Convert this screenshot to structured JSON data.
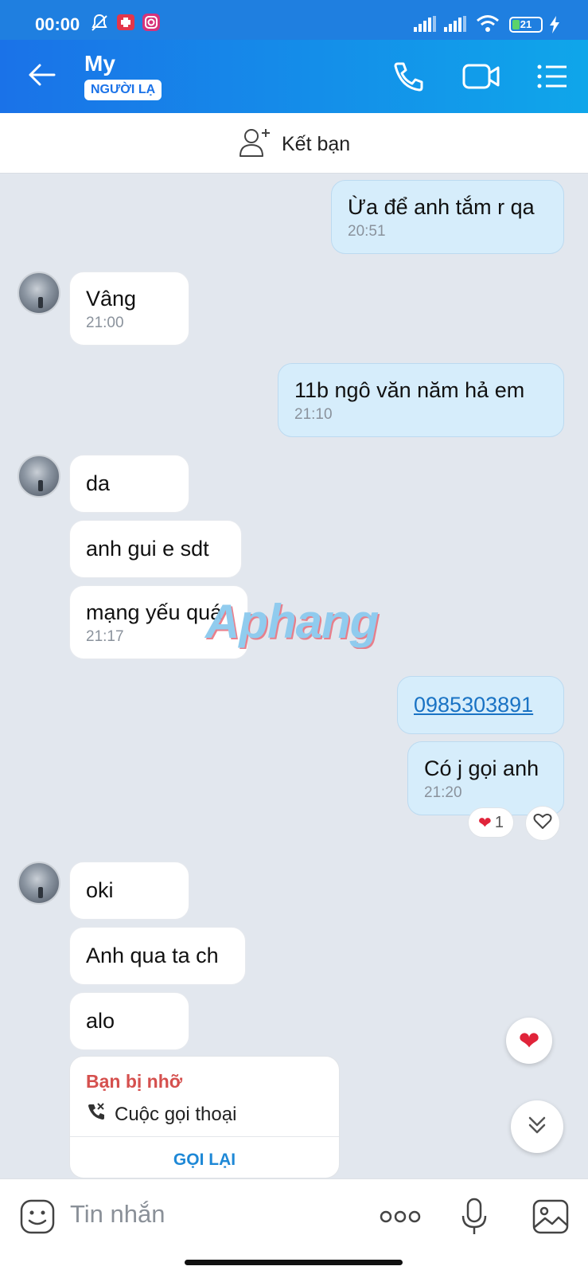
{
  "status_bar": {
    "time": "00:00",
    "battery": "21"
  },
  "header": {
    "contact_name": "My",
    "badge": "NGƯỜI LẠ"
  },
  "add_friend": {
    "label": "Kết bạn"
  },
  "messages": [
    {
      "text": "Ừa để anh tắm r qa",
      "time": "20:51"
    },
    {
      "text": "Vâng",
      "time": "21:00"
    },
    {
      "text": "11b ngô văn năm hả em",
      "time": "21:10"
    },
    {
      "text": "da"
    },
    {
      "text": "anh gui e sdt"
    },
    {
      "text": "mạng yếu quá",
      "time": "21:17"
    },
    {
      "text": "0985303891"
    },
    {
      "text": "Có j gọi anh",
      "time": "21:20"
    },
    {
      "text": "oki"
    },
    {
      "text": "Anh qua ta ch"
    },
    {
      "text": "alo"
    }
  ],
  "reaction": {
    "emoji": "❤️",
    "count": "1"
  },
  "watermark": "Aphang",
  "missed_call": {
    "title": "Bạn bị nhỡ",
    "type": "Cuộc gọi thoại",
    "action": "GỌI LẠI"
  },
  "input": {
    "placeholder": "Tin nhắn"
  }
}
